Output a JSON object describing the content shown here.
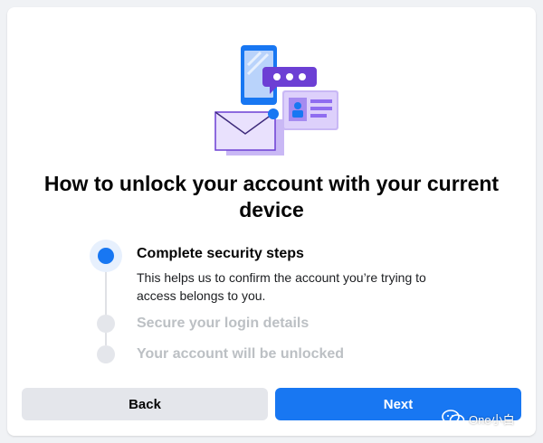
{
  "dialog": {
    "title": "How to unlock your account with your current device",
    "illustration_icon": "phone-chat-envelope-idcard-illustration"
  },
  "steps": [
    {
      "label": "Complete security steps",
      "description": "This helps us to confirm the account you’re trying to access belongs to you.",
      "state": "active"
    },
    {
      "label": "Secure your login details",
      "state": "inactive"
    },
    {
      "label": "Your account will be unlocked",
      "state": "inactive"
    }
  ],
  "actions": {
    "back_label": "Back",
    "next_label": "Next"
  },
  "watermark": {
    "text": "One小白",
    "icon": "wechat-icon"
  },
  "colors": {
    "accent": "#1877f2",
    "accent_halo": "#e7f0fd",
    "inactive_dot": "#e4e6eb",
    "inactive_text": "#bcc0c4",
    "illustration_purple": "#6c3fd4",
    "illustration_lavender": "#c9b8f5"
  }
}
